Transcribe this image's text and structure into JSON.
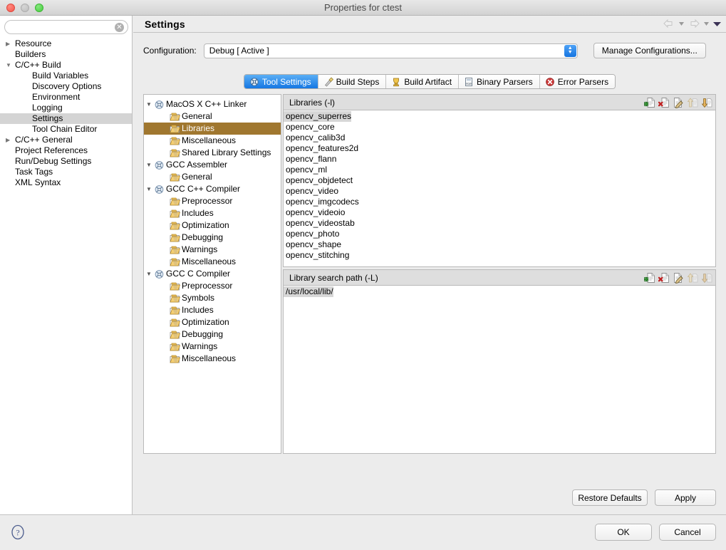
{
  "window": {
    "title": "Properties for ctest",
    "traffic_lights": [
      "close",
      "minimize",
      "maximize"
    ]
  },
  "sidebar": {
    "search": {
      "value": "",
      "placeholder": ""
    },
    "items": [
      {
        "label": "Resource",
        "depth": 1,
        "twisty": "collapsed",
        "selected": false
      },
      {
        "label": "Builders",
        "depth": 1,
        "twisty": "none",
        "selected": false
      },
      {
        "label": "C/C++ Build",
        "depth": 1,
        "twisty": "expanded",
        "selected": false
      },
      {
        "label": "Build Variables",
        "depth": 2,
        "twisty": "none",
        "selected": false
      },
      {
        "label": "Discovery Options",
        "depth": 2,
        "twisty": "none",
        "selected": false
      },
      {
        "label": "Environment",
        "depth": 2,
        "twisty": "none",
        "selected": false
      },
      {
        "label": "Logging",
        "depth": 2,
        "twisty": "none",
        "selected": false
      },
      {
        "label": "Settings",
        "depth": 2,
        "twisty": "none",
        "selected": true
      },
      {
        "label": "Tool Chain Editor",
        "depth": 2,
        "twisty": "none",
        "selected": false
      },
      {
        "label": "C/C++ General",
        "depth": 1,
        "twisty": "collapsed",
        "selected": false
      },
      {
        "label": "Project References",
        "depth": 1,
        "twisty": "none",
        "selected": false
      },
      {
        "label": "Run/Debug Settings",
        "depth": 1,
        "twisty": "none",
        "selected": false
      },
      {
        "label": "Task Tags",
        "depth": 1,
        "twisty": "none",
        "selected": false
      },
      {
        "label": "XML Syntax",
        "depth": 1,
        "twisty": "none",
        "selected": false
      }
    ]
  },
  "page": {
    "title": "Settings",
    "nav": {
      "back_icon": "back-arrow-icon",
      "back_menu_icon": "chevron-down-icon",
      "forward_icon": "forward-arrow-icon",
      "forward_menu_icon": "chevron-down-icon",
      "view_menu_icon": "triangle-down-icon"
    }
  },
  "configuration": {
    "label": "Configuration:",
    "value": "Debug  [ Active ]",
    "manage_button": "Manage Configurations..."
  },
  "tabs": [
    {
      "label": "Tool Settings",
      "icon": "tool-settings-icon",
      "active": true
    },
    {
      "label": "Build Steps",
      "icon": "build-steps-icon",
      "active": false
    },
    {
      "label": "Build Artifact",
      "icon": "build-artifact-icon",
      "active": false
    },
    {
      "label": "Binary Parsers",
      "icon": "binary-parsers-icon",
      "active": false
    },
    {
      "label": "Error Parsers",
      "icon": "error-parsers-icon",
      "active": false
    }
  ],
  "tool_tree": [
    {
      "label": "MacOS X C++ Linker",
      "level": 1,
      "twisty": "expanded",
      "icon": "tool-icon",
      "selected": false
    },
    {
      "label": "General",
      "level": 2,
      "twisty": "none",
      "icon": "folder-icon",
      "selected": false
    },
    {
      "label": "Libraries",
      "level": 2,
      "twisty": "none",
      "icon": "folder-icon",
      "selected": true
    },
    {
      "label": "Miscellaneous",
      "level": 2,
      "twisty": "none",
      "icon": "folder-icon",
      "selected": false
    },
    {
      "label": "Shared Library Settings",
      "level": 2,
      "twisty": "none",
      "icon": "folder-icon",
      "selected": false
    },
    {
      "label": "GCC Assembler",
      "level": 1,
      "twisty": "expanded",
      "icon": "tool-icon",
      "selected": false
    },
    {
      "label": "General",
      "level": 2,
      "twisty": "none",
      "icon": "folder-icon",
      "selected": false
    },
    {
      "label": "GCC C++ Compiler",
      "level": 1,
      "twisty": "expanded",
      "icon": "tool-icon",
      "selected": false
    },
    {
      "label": "Preprocessor",
      "level": 2,
      "twisty": "none",
      "icon": "folder-icon",
      "selected": false
    },
    {
      "label": "Includes",
      "level": 2,
      "twisty": "none",
      "icon": "folder-icon",
      "selected": false
    },
    {
      "label": "Optimization",
      "level": 2,
      "twisty": "none",
      "icon": "folder-icon",
      "selected": false
    },
    {
      "label": "Debugging",
      "level": 2,
      "twisty": "none",
      "icon": "folder-icon",
      "selected": false
    },
    {
      "label": "Warnings",
      "level": 2,
      "twisty": "none",
      "icon": "folder-icon",
      "selected": false
    },
    {
      "label": "Miscellaneous",
      "level": 2,
      "twisty": "none",
      "icon": "folder-icon",
      "selected": false
    },
    {
      "label": "GCC C Compiler",
      "level": 1,
      "twisty": "expanded",
      "icon": "tool-icon",
      "selected": false
    },
    {
      "label": "Preprocessor",
      "level": 2,
      "twisty": "none",
      "icon": "folder-icon",
      "selected": false
    },
    {
      "label": "Symbols",
      "level": 2,
      "twisty": "none",
      "icon": "folder-icon",
      "selected": false
    },
    {
      "label": "Includes",
      "level": 2,
      "twisty": "none",
      "icon": "folder-icon",
      "selected": false
    },
    {
      "label": "Optimization",
      "level": 2,
      "twisty": "none",
      "icon": "folder-icon",
      "selected": false
    },
    {
      "label": "Debugging",
      "level": 2,
      "twisty": "none",
      "icon": "folder-icon",
      "selected": false
    },
    {
      "label": "Warnings",
      "level": 2,
      "twisty": "none",
      "icon": "folder-icon",
      "selected": false
    },
    {
      "label": "Miscellaneous",
      "level": 2,
      "twisty": "none",
      "icon": "folder-icon",
      "selected": false
    }
  ],
  "libraries_panel": {
    "title": "Libraries (-l)",
    "toolbar": [
      {
        "name": "add-icon",
        "enabled": true
      },
      {
        "name": "delete-icon",
        "enabled": true
      },
      {
        "name": "edit-icon",
        "enabled": true
      },
      {
        "name": "move-up-icon",
        "enabled": false
      },
      {
        "name": "move-down-icon",
        "enabled": true
      }
    ],
    "items": [
      {
        "value": "opencv_superres",
        "selected": true
      },
      {
        "value": "opencv_core",
        "selected": false
      },
      {
        "value": "opencv_calib3d",
        "selected": false
      },
      {
        "value": "opencv_features2d",
        "selected": false
      },
      {
        "value": "opencv_flann",
        "selected": false
      },
      {
        "value": "opencv_ml",
        "selected": false
      },
      {
        "value": "opencv_objdetect",
        "selected": false
      },
      {
        "value": "opencv_video",
        "selected": false
      },
      {
        "value": "opencv_imgcodecs",
        "selected": false
      },
      {
        "value": "opencv_videoio",
        "selected": false
      },
      {
        "value": "opencv_videostab",
        "selected": false
      },
      {
        "value": "opencv_photo",
        "selected": false
      },
      {
        "value": "opencv_shape",
        "selected": false
      },
      {
        "value": "opencv_stitching",
        "selected": false
      }
    ]
  },
  "search_path_panel": {
    "title": "Library search path (-L)",
    "toolbar": [
      {
        "name": "add-icon",
        "enabled": true
      },
      {
        "name": "delete-icon",
        "enabled": true
      },
      {
        "name": "edit-icon",
        "enabled": true
      },
      {
        "name": "move-up-icon",
        "enabled": false
      },
      {
        "name": "move-down-icon",
        "enabled": false
      }
    ],
    "items": [
      {
        "value": "/usr/local/lib/",
        "selected": true
      }
    ]
  },
  "actions": {
    "restore_defaults": "Restore Defaults",
    "apply": "Apply"
  },
  "footer": {
    "help_icon": "help-icon",
    "ok": "OK",
    "cancel": "Cancel"
  },
  "colors": {
    "window_bg": "#ececec",
    "panel_bg": "#ffffff",
    "selection_sidebar": "#d4d4d4",
    "selection_tool_tree": "#a0772f",
    "selection_list": "#d7d7d7",
    "tab_active": "#1577e3",
    "combo_arrow": "#1574e0"
  }
}
